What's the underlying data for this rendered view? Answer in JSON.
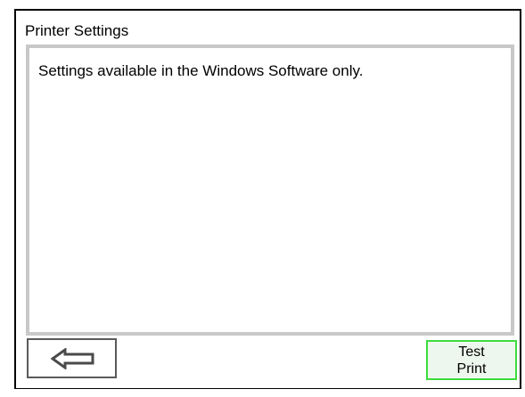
{
  "window": {
    "title": "Printer Settings"
  },
  "content": {
    "message": "Settings available in the Windows Software only."
  },
  "buttons": {
    "back_icon": "left-arrow-icon",
    "test_print_line1": "Test",
    "test_print_line2": "Print"
  },
  "colors": {
    "panel_border": "#c8c8c8",
    "test_print_border": "#3ddc3d",
    "test_print_background": "#edf7ed",
    "back_button_border": "#5a5a5a"
  }
}
